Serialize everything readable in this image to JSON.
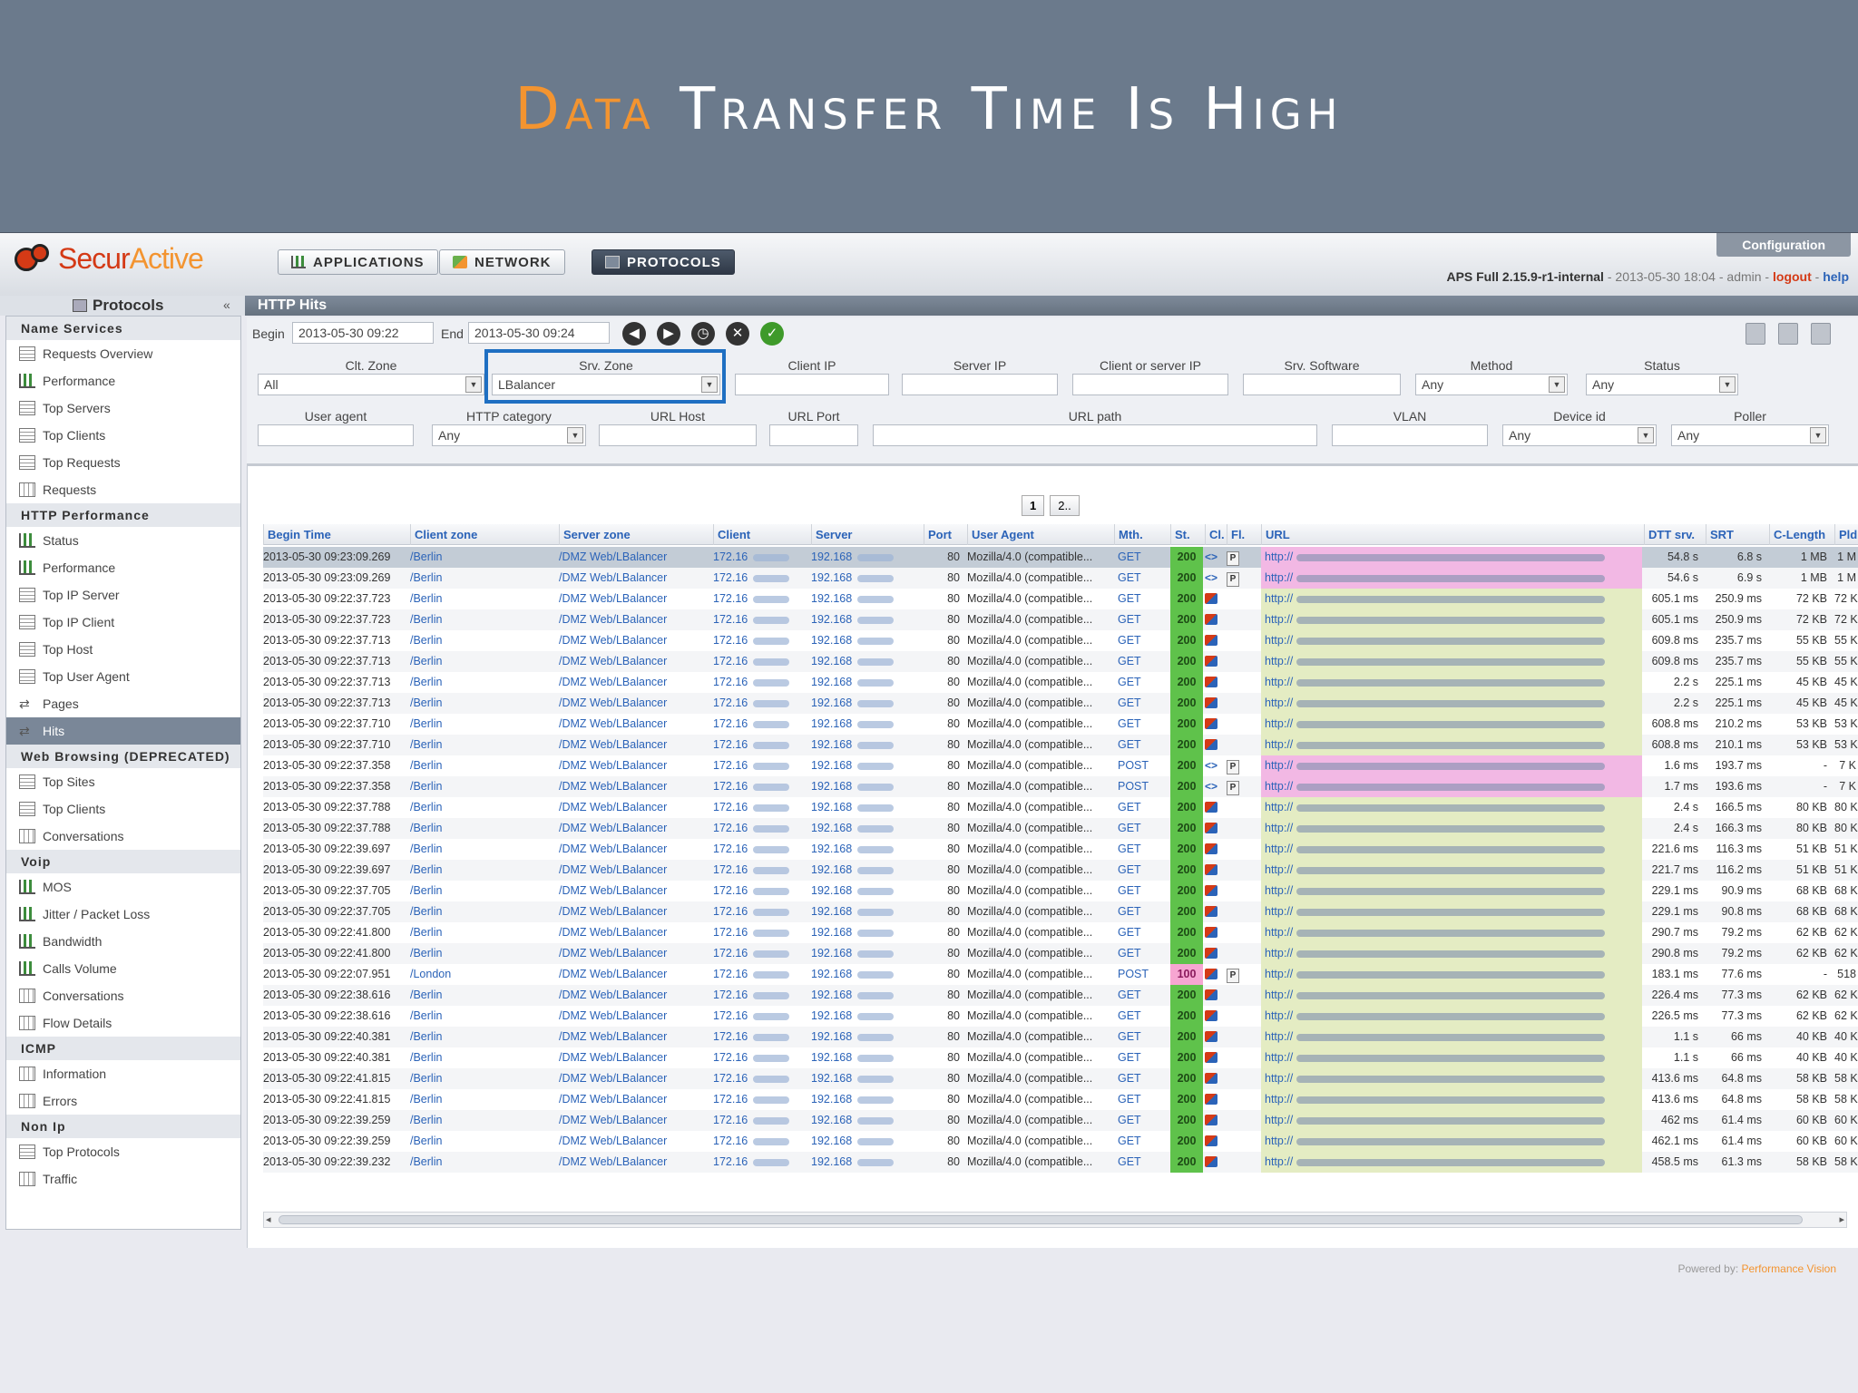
{
  "slide": {
    "title_accent": "Data",
    "title_rest": " Transfer Time Is High"
  },
  "app": {
    "brand_prefix": "Secur",
    "brand_suffix": "Active",
    "tabs": [
      {
        "label": "APPLICATIONS",
        "icon": "chart-icon"
      },
      {
        "label": "NETWORK",
        "icon": "network-icon"
      },
      {
        "label": "PROTOCOLS",
        "icon": "protocols-icon",
        "active": true
      }
    ],
    "configuration_label": "Configuration",
    "version": "APS Full 2.15.9-r1-internal",
    "version_sep1": " - ",
    "timestamp": "2013-05-30 18:04",
    "version_sep2": " - ",
    "user": "admin",
    "version_sep3": " - ",
    "logout": "logout",
    "version_sep4": " - ",
    "help": "help"
  },
  "sidebar": {
    "title": "Protocols",
    "sections": [
      {
        "name": "Name Services",
        "items": [
          {
            "label": "Requests Overview",
            "icon": "list"
          },
          {
            "label": "Performance",
            "icon": "chart"
          },
          {
            "label": "Top Servers",
            "icon": "list"
          },
          {
            "label": "Top Clients",
            "icon": "list"
          },
          {
            "label": "Top Requests",
            "icon": "list"
          },
          {
            "label": "Requests",
            "icon": "grid"
          }
        ]
      },
      {
        "name": "HTTP Performance",
        "items": [
          {
            "label": "Status",
            "icon": "chart"
          },
          {
            "label": "Performance",
            "icon": "chart"
          },
          {
            "label": "Top IP Server",
            "icon": "list"
          },
          {
            "label": "Top IP Client",
            "icon": "list"
          },
          {
            "label": "Top Host",
            "icon": "list"
          },
          {
            "label": "Top User Agent",
            "icon": "list"
          },
          {
            "label": "Pages",
            "icon": "arrows"
          },
          {
            "label": "Hits",
            "icon": "arrows",
            "active": true
          }
        ]
      },
      {
        "name": "Web Browsing (DEPRECATED)",
        "items": [
          {
            "label": "Top Sites",
            "icon": "list"
          },
          {
            "label": "Top Clients",
            "icon": "list"
          },
          {
            "label": "Conversations",
            "icon": "grid"
          }
        ]
      },
      {
        "name": "Voip",
        "items": [
          {
            "label": "MOS",
            "icon": "chart"
          },
          {
            "label": "Jitter / Packet Loss",
            "icon": "chart"
          },
          {
            "label": "Bandwidth",
            "icon": "chart"
          },
          {
            "label": "Calls Volume",
            "icon": "chart"
          },
          {
            "label": "Conversations",
            "icon": "grid"
          },
          {
            "label": "Flow Details",
            "icon": "grid"
          }
        ]
      },
      {
        "name": "ICMP",
        "items": [
          {
            "label": "Information",
            "icon": "grid"
          },
          {
            "label": "Errors",
            "icon": "grid"
          }
        ]
      },
      {
        "name": "Non Ip",
        "items": [
          {
            "label": "Top Protocols",
            "icon": "list"
          },
          {
            "label": "Traffic",
            "icon": "grid"
          }
        ]
      }
    ]
  },
  "panel": {
    "title": "HTTP Hits",
    "begin_label": "Begin",
    "begin_value": "2013-05-30 09:22",
    "end_label": "End",
    "end_value": "2013-05-30 09:24",
    "filters_row1": [
      {
        "label": "Clt. Zone",
        "value": "All",
        "type": "select"
      },
      {
        "label": "Srv. Zone",
        "value": "LBalancer",
        "type": "select"
      },
      {
        "label": "Client IP",
        "value": "",
        "type": "input"
      },
      {
        "label": "Server IP",
        "value": "",
        "type": "input"
      },
      {
        "label": "Client or server IP",
        "value": "",
        "type": "input"
      },
      {
        "label": "Srv. Software",
        "value": "",
        "type": "input"
      },
      {
        "label": "Method",
        "value": "Any",
        "type": "select"
      },
      {
        "label": "Status",
        "value": "Any",
        "type": "select"
      }
    ],
    "filters_row2": [
      {
        "label": "User agent",
        "value": "",
        "type": "input"
      },
      {
        "label": "HTTP category",
        "value": "Any",
        "type": "select"
      },
      {
        "label": "URL Host",
        "value": "",
        "type": "input"
      },
      {
        "label": "URL Port",
        "value": "",
        "type": "input"
      },
      {
        "label": "URL path",
        "value": "",
        "type": "input"
      },
      {
        "label": "VLAN",
        "value": "",
        "type": "input"
      },
      {
        "label": "Device id",
        "value": "Any",
        "type": "select"
      },
      {
        "label": "Poller",
        "value": "Any",
        "type": "select"
      }
    ],
    "pages": [
      "1",
      "2.."
    ]
  },
  "table": {
    "columns": [
      "Begin Time",
      "Client zone",
      "Server zone",
      "Client",
      "Server",
      "Port",
      "User Agent",
      "Mth.",
      "St.",
      "Cl.",
      "Fl.",
      "URL",
      "DTT srv.",
      "SRT",
      "C-Length",
      "Pld"
    ],
    "rows": [
      [
        "2013-05-30 09:23:09.269",
        "/Berlin",
        "/DMZ Web/LBalancer",
        "172.16",
        "192.168",
        "80",
        "Mozilla/4.0 (compatible...",
        "GET",
        "200",
        "<>",
        "P",
        "http://",
        "54.8 s",
        "6.8 s",
        "1 MB",
        "1 M"
      ],
      [
        "2013-05-30 09:23:09.269",
        "/Berlin",
        "/DMZ Web/LBalancer",
        "172.16",
        "192.168",
        "80",
        "Mozilla/4.0 (compatible...",
        "GET",
        "200",
        "<>",
        "P",
        "http://",
        "54.6 s",
        "6.9 s",
        "1 MB",
        "1 M"
      ],
      [
        "2013-05-30 09:22:37.723",
        "/Berlin",
        "/DMZ Web/LBalancer",
        "172.16",
        "192.168",
        "80",
        "Mozilla/4.0 (compatible...",
        "GET",
        "200",
        "",
        "",
        "http://",
        "605.1 ms",
        "250.9 ms",
        "72 KB",
        "72 K"
      ],
      [
        "2013-05-30 09:22:37.723",
        "/Berlin",
        "/DMZ Web/LBalancer",
        "172.16",
        "192.168",
        "80",
        "Mozilla/4.0 (compatible...",
        "GET",
        "200",
        "",
        "",
        "http://",
        "605.1 ms",
        "250.9 ms",
        "72 KB",
        "72 K"
      ],
      [
        "2013-05-30 09:22:37.713",
        "/Berlin",
        "/DMZ Web/LBalancer",
        "172.16",
        "192.168",
        "80",
        "Mozilla/4.0 (compatible...",
        "GET",
        "200",
        "",
        "",
        "http://",
        "609.8 ms",
        "235.7 ms",
        "55 KB",
        "55 K"
      ],
      [
        "2013-05-30 09:22:37.713",
        "/Berlin",
        "/DMZ Web/LBalancer",
        "172.16",
        "192.168",
        "80",
        "Mozilla/4.0 (compatible...",
        "GET",
        "200",
        "",
        "",
        "http://",
        "609.8 ms",
        "235.7 ms",
        "55 KB",
        "55 K"
      ],
      [
        "2013-05-30 09:22:37.713",
        "/Berlin",
        "/DMZ Web/LBalancer",
        "172.16",
        "192.168",
        "80",
        "Mozilla/4.0 (compatible...",
        "GET",
        "200",
        "",
        "",
        "http://",
        "2.2 s",
        "225.1 ms",
        "45 KB",
        "45 K"
      ],
      [
        "2013-05-30 09:22:37.713",
        "/Berlin",
        "/DMZ Web/LBalancer",
        "172.16",
        "192.168",
        "80",
        "Mozilla/4.0 (compatible...",
        "GET",
        "200",
        "",
        "",
        "http://",
        "2.2 s",
        "225.1 ms",
        "45 KB",
        "45 K"
      ],
      [
        "2013-05-30 09:22:37.710",
        "/Berlin",
        "/DMZ Web/LBalancer",
        "172.16",
        "192.168",
        "80",
        "Mozilla/4.0 (compatible...",
        "GET",
        "200",
        "",
        "",
        "http://",
        "608.8 ms",
        "210.2 ms",
        "53 KB",
        "53 K"
      ],
      [
        "2013-05-30 09:22:37.710",
        "/Berlin",
        "/DMZ Web/LBalancer",
        "172.16",
        "192.168",
        "80",
        "Mozilla/4.0 (compatible...",
        "GET",
        "200",
        "",
        "",
        "http://",
        "608.8 ms",
        "210.1 ms",
        "53 KB",
        "53 K"
      ],
      [
        "2013-05-30 09:22:37.358",
        "/Berlin",
        "/DMZ Web/LBalancer",
        "172.16",
        "192.168",
        "80",
        "Mozilla/4.0 (compatible...",
        "POST",
        "200",
        "<>",
        "P",
        "http://",
        "1.6 ms",
        "193.7 ms",
        "-",
        "7 K"
      ],
      [
        "2013-05-30 09:22:37.358",
        "/Berlin",
        "/DMZ Web/LBalancer",
        "172.16",
        "192.168",
        "80",
        "Mozilla/4.0 (compatible...",
        "POST",
        "200",
        "<>",
        "P",
        "http://",
        "1.7 ms",
        "193.6 ms",
        "-",
        "7 K"
      ],
      [
        "2013-05-30 09:22:37.788",
        "/Berlin",
        "/DMZ Web/LBalancer",
        "172.16",
        "192.168",
        "80",
        "Mozilla/4.0 (compatible...",
        "GET",
        "200",
        "",
        "",
        "http://",
        "2.4 s",
        "166.5 ms",
        "80 KB",
        "80 K"
      ],
      [
        "2013-05-30 09:22:37.788",
        "/Berlin",
        "/DMZ Web/LBalancer",
        "172.16",
        "192.168",
        "80",
        "Mozilla/4.0 (compatible...",
        "GET",
        "200",
        "",
        "",
        "http://",
        "2.4 s",
        "166.3 ms",
        "80 KB",
        "80 K"
      ],
      [
        "2013-05-30 09:22:39.697",
        "/Berlin",
        "/DMZ Web/LBalancer",
        "172.16",
        "192.168",
        "80",
        "Mozilla/4.0 (compatible...",
        "GET",
        "200",
        "",
        "",
        "http://",
        "221.6 ms",
        "116.3 ms",
        "51 KB",
        "51 K"
      ],
      [
        "2013-05-30 09:22:39.697",
        "/Berlin",
        "/DMZ Web/LBalancer",
        "172.16",
        "192.168",
        "80",
        "Mozilla/4.0 (compatible...",
        "GET",
        "200",
        "",
        "",
        "http://",
        "221.7 ms",
        "116.2 ms",
        "51 KB",
        "51 K"
      ],
      [
        "2013-05-30 09:22:37.705",
        "/Berlin",
        "/DMZ Web/LBalancer",
        "172.16",
        "192.168",
        "80",
        "Mozilla/4.0 (compatible...",
        "GET",
        "200",
        "",
        "",
        "http://",
        "229.1 ms",
        "90.9 ms",
        "68 KB",
        "68 K"
      ],
      [
        "2013-05-30 09:22:37.705",
        "/Berlin",
        "/DMZ Web/LBalancer",
        "172.16",
        "192.168",
        "80",
        "Mozilla/4.0 (compatible...",
        "GET",
        "200",
        "",
        "",
        "http://",
        "229.1 ms",
        "90.8 ms",
        "68 KB",
        "68 K"
      ],
      [
        "2013-05-30 09:22:41.800",
        "/Berlin",
        "/DMZ Web/LBalancer",
        "172.16",
        "192.168",
        "80",
        "Mozilla/4.0 (compatible...",
        "GET",
        "200",
        "",
        "",
        "http://",
        "290.7 ms",
        "79.2 ms",
        "62 KB",
        "62 K"
      ],
      [
        "2013-05-30 09:22:41.800",
        "/Berlin",
        "/DMZ Web/LBalancer",
        "172.16",
        "192.168",
        "80",
        "Mozilla/4.0 (compatible...",
        "GET",
        "200",
        "",
        "",
        "http://",
        "290.8 ms",
        "79.2 ms",
        "62 KB",
        "62 K"
      ],
      [
        "2013-05-30 09:22:07.951",
        "/London",
        "/DMZ Web/LBalancer",
        "172.16",
        "192.168",
        "80",
        "Mozilla/4.0 (compatible...",
        "POST",
        "100",
        "",
        "P",
        "http://",
        "183.1 ms",
        "77.6 ms",
        "-",
        "518"
      ],
      [
        "2013-05-30 09:22:38.616",
        "/Berlin",
        "/DMZ Web/LBalancer",
        "172.16",
        "192.168",
        "80",
        "Mozilla/4.0 (compatible...",
        "GET",
        "200",
        "",
        "",
        "http://",
        "226.4 ms",
        "77.3 ms",
        "62 KB",
        "62 K"
      ],
      [
        "2013-05-30 09:22:38.616",
        "/Berlin",
        "/DMZ Web/LBalancer",
        "172.16",
        "192.168",
        "80",
        "Mozilla/4.0 (compatible...",
        "GET",
        "200",
        "",
        "",
        "http://",
        "226.5 ms",
        "77.3 ms",
        "62 KB",
        "62 K"
      ],
      [
        "2013-05-30 09:22:40.381",
        "/Berlin",
        "/DMZ Web/LBalancer",
        "172.16",
        "192.168",
        "80",
        "Mozilla/4.0 (compatible...",
        "GET",
        "200",
        "",
        "",
        "http://",
        "1.1 s",
        "66 ms",
        "40 KB",
        "40 K"
      ],
      [
        "2013-05-30 09:22:40.381",
        "/Berlin",
        "/DMZ Web/LBalancer",
        "172.16",
        "192.168",
        "80",
        "Mozilla/4.0 (compatible...",
        "GET",
        "200",
        "",
        "",
        "http://",
        "1.1 s",
        "66 ms",
        "40 KB",
        "40 K"
      ],
      [
        "2013-05-30 09:22:41.815",
        "/Berlin",
        "/DMZ Web/LBalancer",
        "172.16",
        "192.168",
        "80",
        "Mozilla/4.0 (compatible...",
        "GET",
        "200",
        "",
        "",
        "http://",
        "413.6 ms",
        "64.8 ms",
        "58 KB",
        "58 K"
      ],
      [
        "2013-05-30 09:22:41.815",
        "/Berlin",
        "/DMZ Web/LBalancer",
        "172.16",
        "192.168",
        "80",
        "Mozilla/4.0 (compatible...",
        "GET",
        "200",
        "",
        "",
        "http://",
        "413.6 ms",
        "64.8 ms",
        "58 KB",
        "58 K"
      ],
      [
        "2013-05-30 09:22:39.259",
        "/Berlin",
        "/DMZ Web/LBalancer",
        "172.16",
        "192.168",
        "80",
        "Mozilla/4.0 (compatible...",
        "GET",
        "200",
        "",
        "",
        "http://",
        "462 ms",
        "61.4 ms",
        "60 KB",
        "60 K"
      ],
      [
        "2013-05-30 09:22:39.259",
        "/Berlin",
        "/DMZ Web/LBalancer",
        "172.16",
        "192.168",
        "80",
        "Mozilla/4.0 (compatible...",
        "GET",
        "200",
        "",
        "",
        "http://",
        "462.1 ms",
        "61.4 ms",
        "60 KB",
        "60 K"
      ],
      [
        "2013-05-30 09:22:39.232",
        "/Berlin",
        "/DMZ Web/LBalancer",
        "172.16",
        "192.168",
        "80",
        "Mozilla/4.0 (compatible...",
        "GET",
        "200",
        "",
        "",
        "http://",
        "458.5 ms",
        "61.3 ms",
        "58 KB",
        "58 K"
      ]
    ]
  },
  "footer": {
    "powered_by": "Powered by: ",
    "brand": "Performance Vision"
  }
}
